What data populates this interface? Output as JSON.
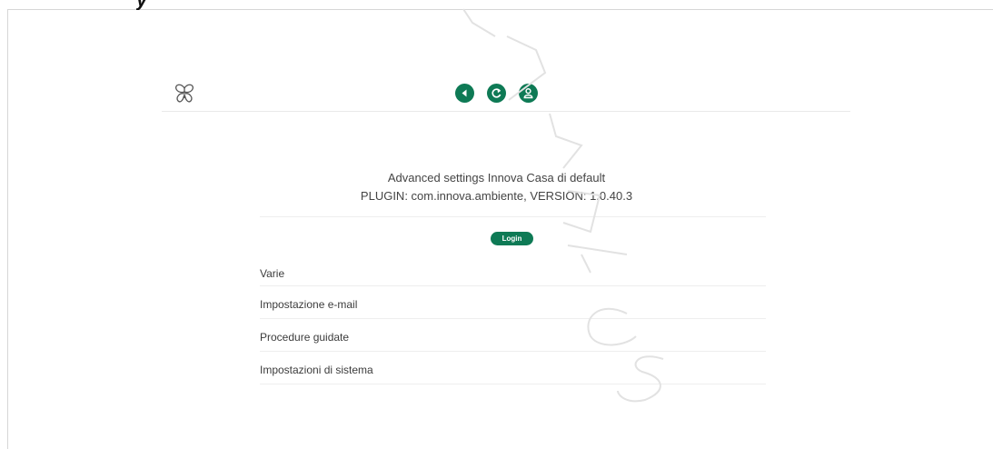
{
  "header": {
    "icons": {
      "logo": "butterfly-icon",
      "back": "back-arrow-icon",
      "refresh": "refresh-icon",
      "user": "user-icon"
    },
    "accent_color": "#0e7a55"
  },
  "main": {
    "title": "Advanced settings Innova Casa di default",
    "plugin_info": "PLUGIN: com.innova.ambiente, VERSION: 1.0.40.3",
    "login_label": "Login",
    "menu": [
      {
        "label": "Varie"
      },
      {
        "label": "Impostazione e-mail"
      },
      {
        "label": "Procedure guidate"
      },
      {
        "label": "Impostazioni di sistema"
      }
    ]
  }
}
